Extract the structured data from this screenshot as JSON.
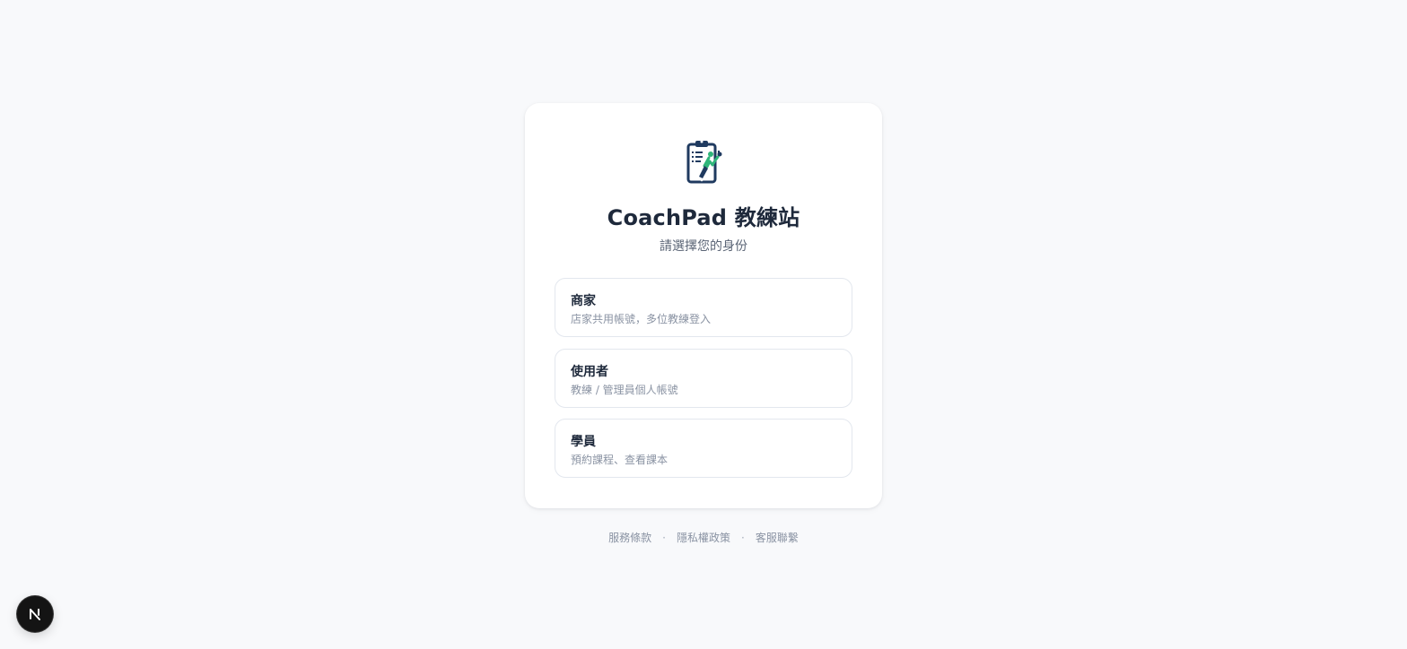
{
  "app": {
    "title": "CoachPad 教練站",
    "subtitle": "請選擇您的身份",
    "logo_icon": "clipboard-coach-icon"
  },
  "options": [
    {
      "title": "商家",
      "description": "店家共用帳號，多位教練登入"
    },
    {
      "title": "使用者",
      "description": "教練 / 管理員個人帳號"
    },
    {
      "title": "學員",
      "description": "預約課程、查看課本"
    }
  ],
  "footer": {
    "links": [
      "服務條款",
      "隱私權政策",
      "客服聯繫"
    ],
    "separator": "·"
  },
  "dev_badge": {
    "icon": "nextjs-icon"
  },
  "colors": {
    "background": "#f8f9fb",
    "card": "#ffffff",
    "title": "#1e293b",
    "muted": "#8a93a3",
    "border": "#e3e7ee",
    "logo_navy": "#1f3a5f",
    "logo_green": "#2fb57a"
  }
}
